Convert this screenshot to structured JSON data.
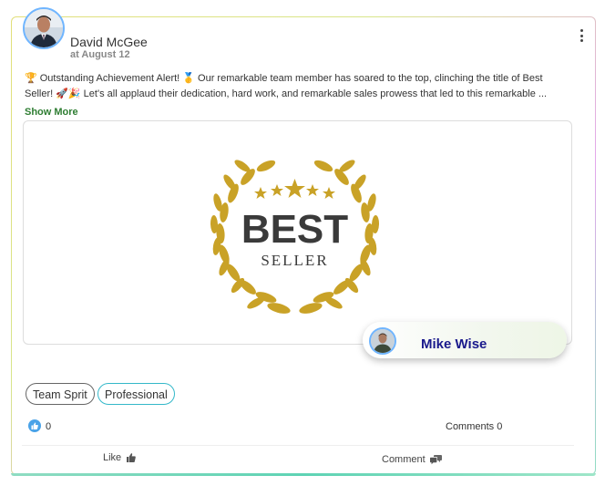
{
  "post": {
    "author": "David McGee",
    "date": "at August 12",
    "text": "🏆 Outstanding Achievement Alert! 🥇 Our remarkable team member has soared to the top, clinching the title of Best Seller! 🚀🎉 Let's all applaud their dedication, hard work, and remarkable sales prowess that led to this remarkable ...",
    "show_more": "Show More"
  },
  "media": {
    "badge_title": "BEST",
    "badge_subtitle": "SELLER",
    "badge_color": "#c9a227"
  },
  "tagged_user": {
    "name": "Mike Wise"
  },
  "tags": [
    "Team Sprit",
    "Professional"
  ],
  "stats": {
    "likes": "0",
    "comments": "Comments 0"
  },
  "actions": {
    "like": "Like",
    "comment": "Comment"
  }
}
